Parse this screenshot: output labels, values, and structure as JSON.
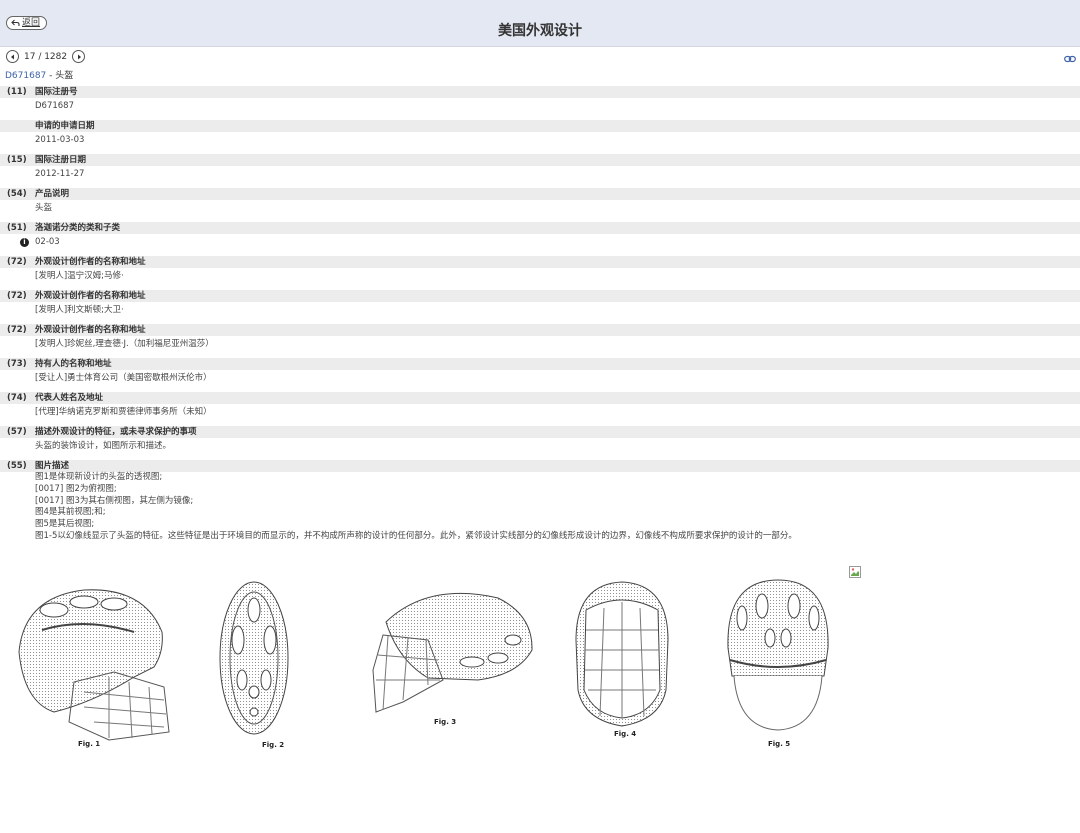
{
  "header": {
    "back_label": "返回",
    "title": "美国外观设计"
  },
  "pager": {
    "current": "17",
    "total": "1282",
    "text": "17 / 1282"
  },
  "doc": {
    "number": "D671687",
    "separator": " - ",
    "name": "头盔"
  },
  "fields": [
    {
      "code": "(11)",
      "label": "国际注册号",
      "value": "D671687"
    },
    {
      "code": "",
      "label": "申请的申请日期",
      "value": "2011-03-03"
    },
    {
      "code": "(15)",
      "label": "国际注册日期",
      "value": "2012-11-27"
    },
    {
      "code": "(54)",
      "label": "产品说明",
      "value": "头盔"
    },
    {
      "code": "(51)",
      "label": "洛迦诺分类的类和子类",
      "value": "02-03"
    },
    {
      "code": "(72)",
      "label": "外观设计创作者的名称和地址",
      "value": "[发明人]温宁汉姆;马修·"
    },
    {
      "code": "(72)",
      "label": "外观设计创作者的名称和地址",
      "value": "[发明人]利文斯顿;大卫·"
    },
    {
      "code": "(72)",
      "label": "外观设计创作者的名称和地址",
      "value": "[发明人]珍妮丝,理查德·J.（加利福尼亚州温莎）"
    },
    {
      "code": "(73)",
      "label": "持有人的名称和地址",
      "value": "[受让人]勇士体育公司（美国密歇根州沃伦市）"
    },
    {
      "code": "(74)",
      "label": "代表人姓名及地址",
      "value": "[代理]华纳诺克罗斯和贾德律师事务所（未知）"
    },
    {
      "code": "(57)",
      "label": "描述外观设计的特征，或未寻求保护的事项",
      "value": "头盔的装饰设计，如图所示和描述。"
    }
  ],
  "figure_desc": {
    "code": "(55)",
    "label": "图片描述",
    "lines": [
      "图1是体现新设计的头盔的透视图;",
      "[0017] 图2为俯视图;",
      "[0017] 图3为其右侧视图，其左侧为镜像;",
      "图4是其前视图;和;",
      "图5是其后视图;",
      "图1-5以幻像线显示了头盔的特征。这些特征是出于环境目的而显示的，并不构成所声称的设计的任何部分。此外，紧邻设计实线部分的幻像线形成设计的边界，幻像线不构成所要求保护的设计的一部分。"
    ]
  },
  "figures": [
    {
      "caption": "Fig. 1"
    },
    {
      "caption": "Fig. 2"
    },
    {
      "caption": "Fig. 3"
    },
    {
      "caption": "Fig. 4"
    },
    {
      "caption": "Fig. 5"
    }
  ],
  "icons": {
    "back": "back-arrow-icon",
    "prev": "chevron-left-icon",
    "next": "chevron-right-icon",
    "link": "link-icon",
    "info": "info-icon",
    "broken": "broken-image-icon"
  }
}
